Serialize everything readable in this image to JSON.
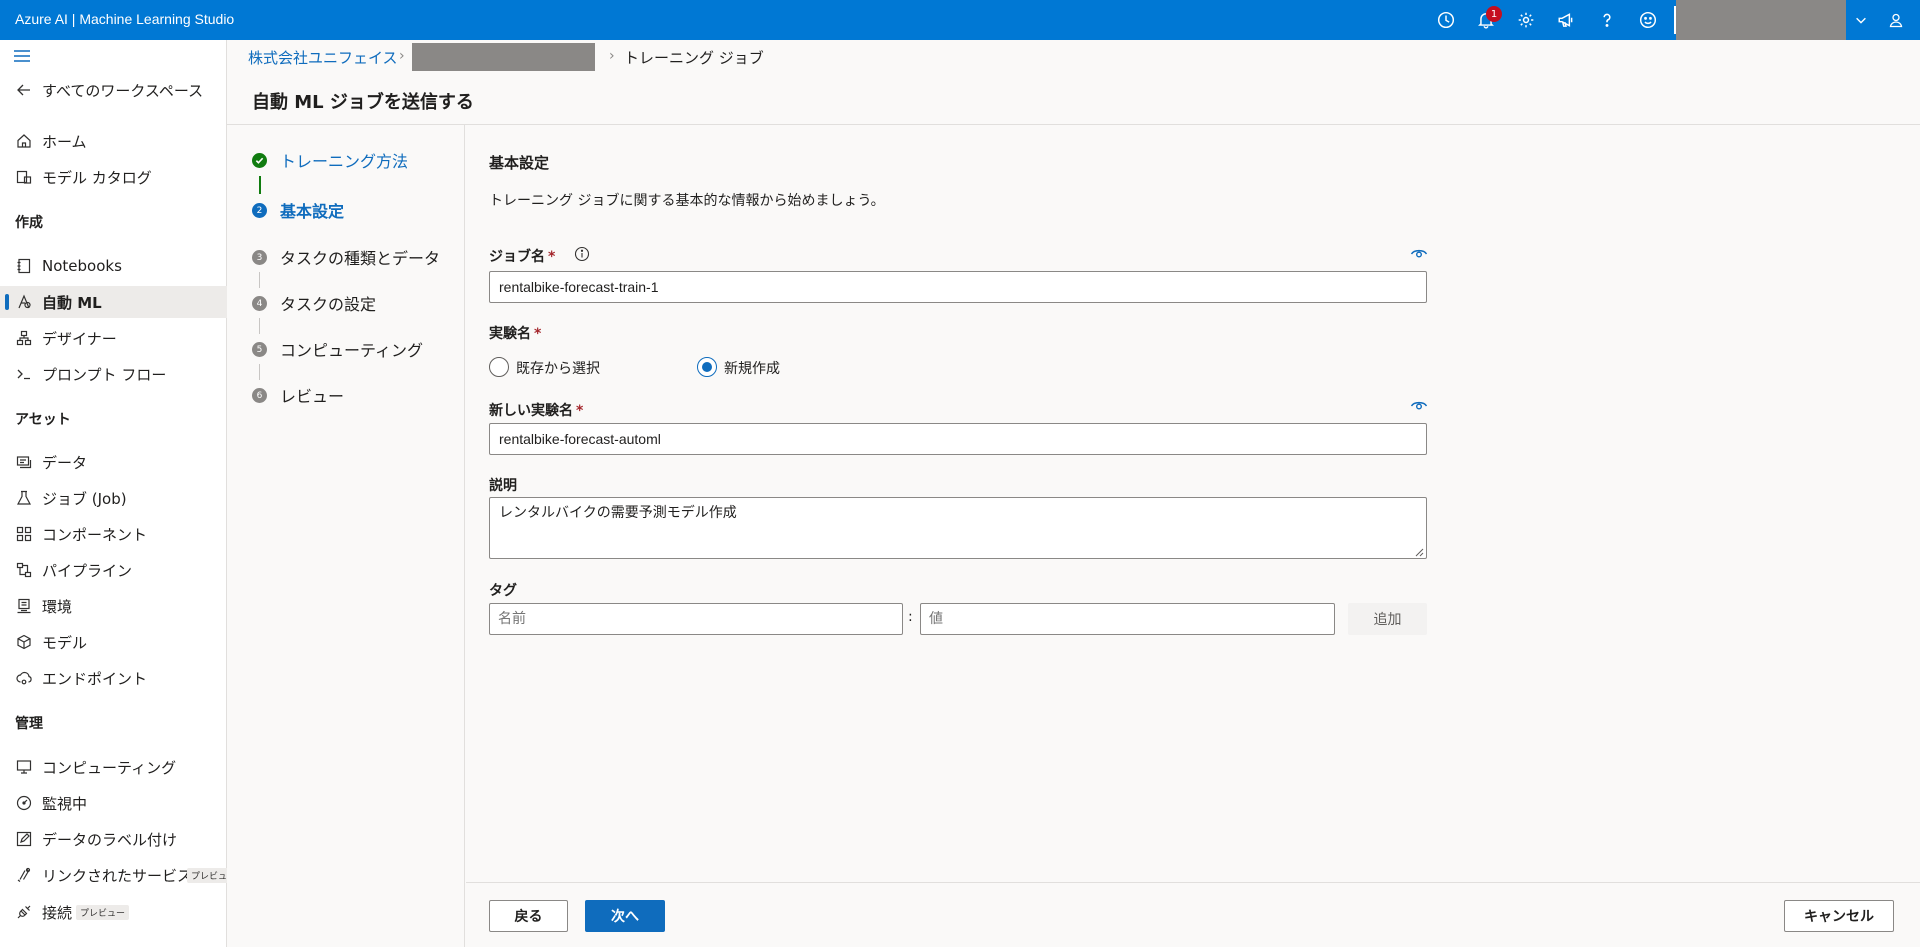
{
  "app": {
    "title": "Azure AI | Machine Learning Studio",
    "notification_count": "1"
  },
  "topbar": {
    "icons": [
      "clock-icon",
      "bell-icon",
      "gear-icon",
      "megaphone-icon",
      "help-icon",
      "smiley-icon"
    ]
  },
  "sidebar": {
    "back_label": "すべてのワークスペース",
    "home": "ホーム",
    "model_catalog": "モデル カタログ",
    "section_create": "作成",
    "notebooks": "Notebooks",
    "automl": "自動 ML",
    "designer": "デザイナー",
    "prompt_flow": "プロンプト フロー",
    "section_assets": "アセット",
    "data": "データ",
    "jobs": "ジョブ (Job)",
    "components": "コンポーネント",
    "pipelines": "パイプライン",
    "environments": "環境",
    "models": "モデル",
    "endpoints": "エンドポイント",
    "section_manage": "管理",
    "compute": "コンピューティング",
    "monitoring": "監視中",
    "data_labeling": "データのラベル付け",
    "linked_services": "リンクされたサービス",
    "linked_services_tag": "プレビュー",
    "connections": "接続",
    "connections_tag": "プレビュー"
  },
  "breadcrumb": {
    "org": "株式会社ユニフェイス",
    "current": "トレーニング ジョブ"
  },
  "page": {
    "title": "自動 ML ジョブを送信する"
  },
  "steps": [
    {
      "num": "✓",
      "label": "トレーニング方法",
      "state": "done"
    },
    {
      "num": "2",
      "label": "基本設定",
      "state": "current"
    },
    {
      "num": "3",
      "label": "タスクの種類とデータ",
      "state": "pending"
    },
    {
      "num": "4",
      "label": "タスクの設定",
      "state": "pending"
    },
    {
      "num": "5",
      "label": "コンピューティング",
      "state": "pending"
    },
    {
      "num": "6",
      "label": "レビュー",
      "state": "pending"
    }
  ],
  "form": {
    "title": "基本設定",
    "description": "トレーニング ジョブに関する基本的な情報から始めましょう。",
    "job_name_label": "ジョブ名",
    "job_name_value": "rentalbike-forecast-train-1",
    "experiment_label": "実験名",
    "radio_existing": "既存から選択",
    "radio_new": "新規作成",
    "new_experiment_label": "新しい実験名",
    "new_experiment_value": "rentalbike-forecast-automl",
    "desc_label": "説明",
    "desc_value": "レンタルバイクの需要予測モデル作成",
    "tags_label": "タグ",
    "tag_name_placeholder": "名前",
    "tag_value_placeholder": "値",
    "add_button": "追加",
    "required_mark": "*"
  },
  "footer": {
    "back": "戻る",
    "next": "次へ",
    "cancel": "キャンセル"
  },
  "colors": {
    "accent": "#0f6cbd",
    "topbar": "#0078d4",
    "done": "#107c10"
  }
}
